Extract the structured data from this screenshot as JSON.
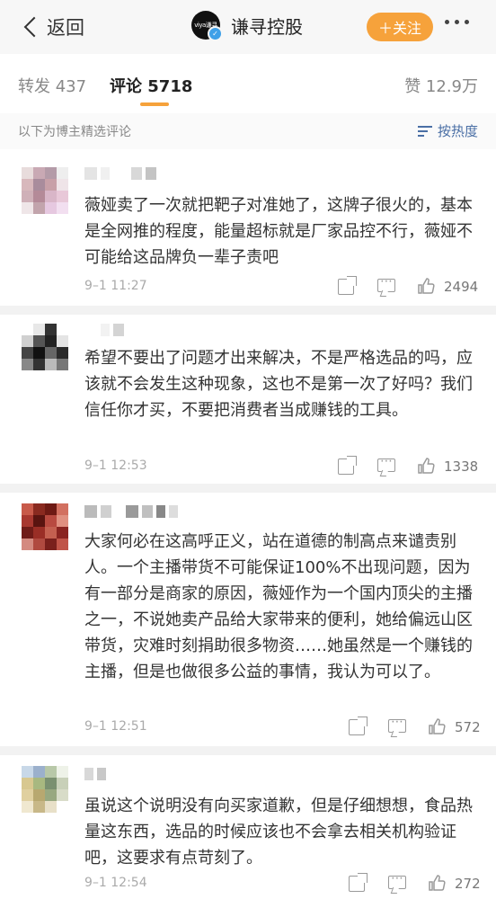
{
  "header": {
    "back_label": "返回",
    "account_name": "谦寻控股",
    "logo_text": "viya谦寻",
    "follow_label": "＋关注"
  },
  "tabs": {
    "repost": "转发 437",
    "comments": "评论 5718",
    "likes": "赞 12.9万"
  },
  "subheader": {
    "label": "以下为博主精选评论",
    "sort_label": "按热度"
  },
  "colors": {
    "accent_orange": "#f6a23b",
    "link_blue": "#4a6fa5"
  },
  "comments": [
    {
      "text": "薇娅卖了一次就把靶子对准她了，这牌子很火的，基本是全网推的程度，能量超标就是厂家品控不行，薇娅不可能给这品牌负一辈子责吧",
      "time": "9–1 11:27",
      "likes": "2494"
    },
    {
      "text": "希望不要出了问题才出来解决，不是严格选品的吗，应该就不会发生这种现象，这也不是第一次了好吗？我们信任你才买，不要把消费者当成赚钱的工具。",
      "time": "9–1 12:53",
      "likes": "1338"
    },
    {
      "text": "大家何必在这高呼正义，站在道德的制高点来谴责别人。一个主播带货不可能保证100%不出现问题，因为有一部分是商家的原因，薇娅作为一个国内顶尖的主播之一，不说她卖产品给大家带来的便利，她给偏远山区带货，灾难时刻捐助很多物资……她虽然是一个赚钱的主播，但是也做很多公益的事情，我认为可以了。",
      "time": "9–1 12:51",
      "likes": "572"
    },
    {
      "text": "虽说这个说明没有向买家道歉，但是仔细想想，食品热量这东西，选品的时候应该也不会拿去相关机构验证吧，这要求有点苛刻了。",
      "time": "9–1 12:54",
      "likes": "272"
    }
  ]
}
